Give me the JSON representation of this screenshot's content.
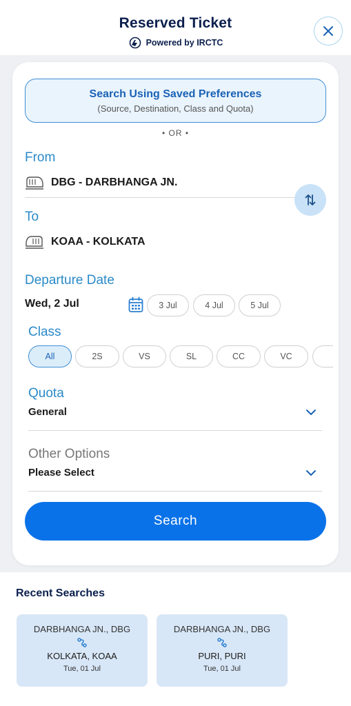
{
  "header": {
    "title": "Reserved Ticket",
    "powered_by": "Powered by IRCTC"
  },
  "saved_preferences": {
    "title": "Search Using Saved Preferences",
    "subtitle": "(Source, Destination, Class and Quota)"
  },
  "or_text": "• OR •",
  "from": {
    "label": "From",
    "station": "DBG - DARBHANGA JN."
  },
  "to": {
    "label": "To",
    "station": "KOAA - KOLKATA"
  },
  "departure": {
    "label": "Departure Date",
    "selected": "Wed, 2 Jul",
    "quick_dates": [
      "3 Jul",
      "4 Jul",
      "5 Jul"
    ]
  },
  "class": {
    "label": "Class",
    "options": [
      "All",
      "2S",
      "VS",
      "SL",
      "CC",
      "VC"
    ],
    "selected": "All"
  },
  "quota": {
    "label": "Quota",
    "value": "General"
  },
  "other_options": {
    "label": "Other Options",
    "value": "Please Select"
  },
  "search_button": "Search",
  "recent": {
    "title": "Recent Searches",
    "items": [
      {
        "from": "DARBHANGA JN., DBG",
        "to": "KOLKATA, KOAA",
        "date": "Tue, 01 Jul"
      },
      {
        "from": "DARBHANGA JN., DBG",
        "to": "PURI, PURI",
        "date": "Tue, 01 Jul"
      }
    ]
  },
  "colors": {
    "accent": "#0a72e8",
    "label_blue": "#2a8ac9",
    "navy": "#0b1f4d",
    "chip_active_bg": "#dcedfa"
  },
  "icons": [
    "irctc-logo-icon",
    "close-icon",
    "train-icon",
    "swap-icon",
    "calendar-icon",
    "chevron-down-icon",
    "route-icon"
  ]
}
